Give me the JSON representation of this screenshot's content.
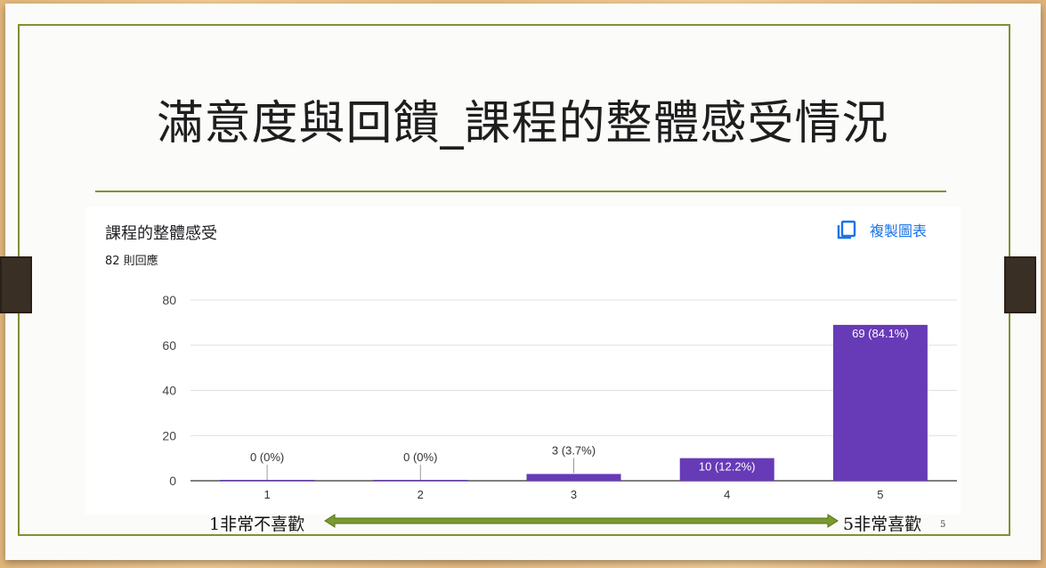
{
  "slide": {
    "title": "滿意度與回饋_課程的整體感受情況",
    "page_number": "5"
  },
  "card": {
    "title": "課程的整體感受",
    "response_count": "82 則回應",
    "copy_chart_label": "複製圖表",
    "copy_icon": "copy-icon",
    "accent_color": "#1a73e8"
  },
  "scale": {
    "left_label": "1非常不喜歡",
    "right_label": "5非常喜歡",
    "arrow_icon": "double-arrow-icon",
    "arrow_color": "#7a9a2e"
  },
  "chart_data": {
    "type": "bar",
    "categories": [
      "1",
      "2",
      "3",
      "4",
      "5"
    ],
    "values": [
      0,
      0,
      3,
      10,
      69
    ],
    "data_labels": [
      "0 (0%)",
      "0 (0%)",
      "3 (3.7%)",
      "10 (12.2%)",
      "69 (84.1%)"
    ],
    "ylim": [
      0,
      80
    ],
    "yticks": [
      0,
      20,
      40,
      60,
      80
    ],
    "grid": true,
    "bar_color": "#673ab7",
    "title": "",
    "xlabel": "",
    "ylabel": ""
  }
}
